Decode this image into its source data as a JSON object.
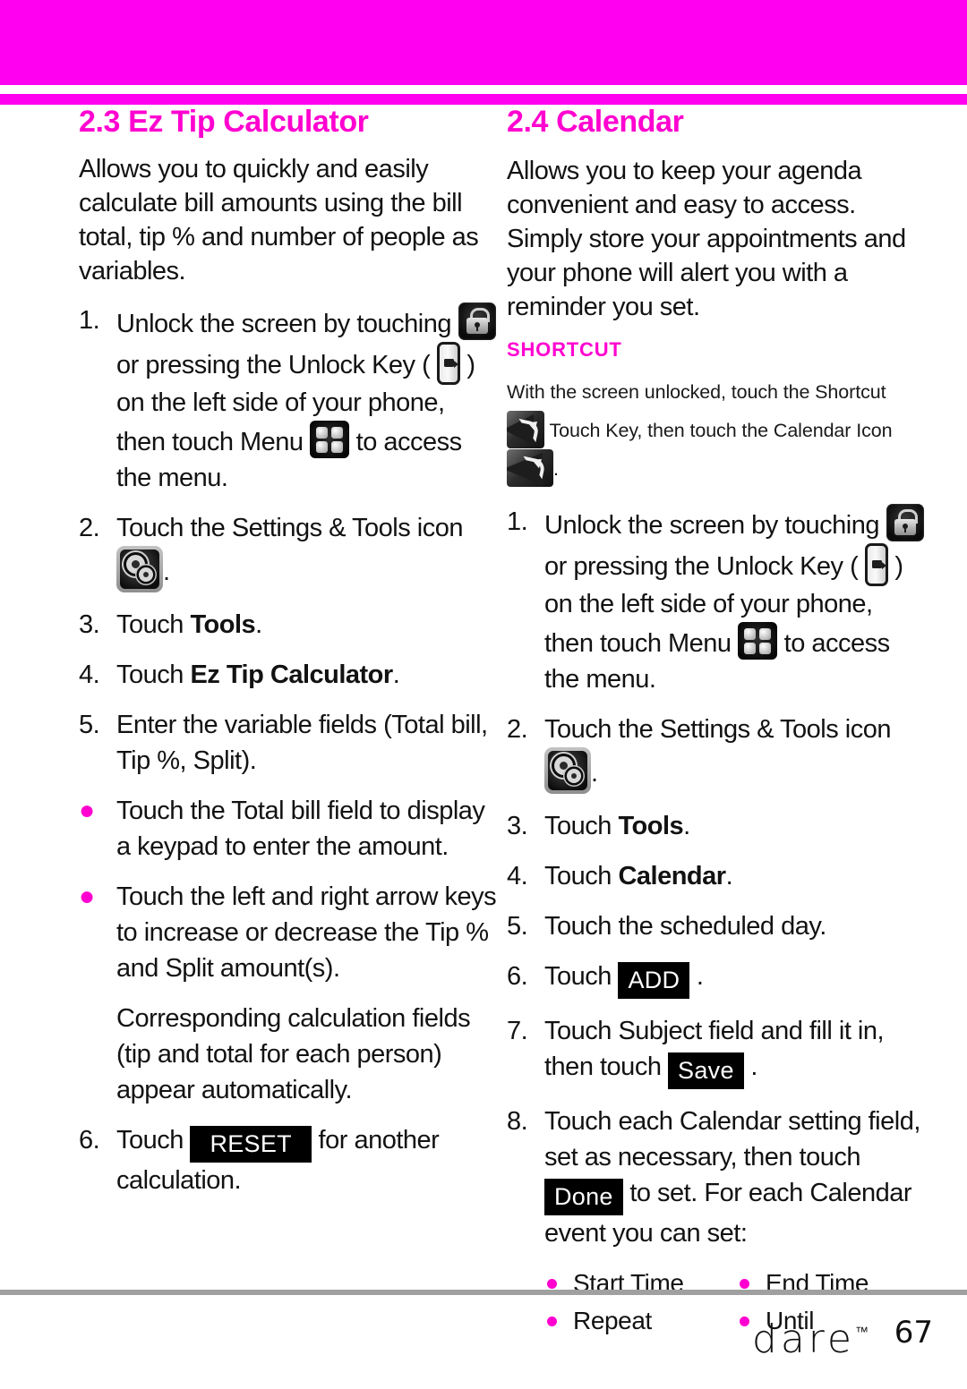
{
  "header": {
    "band_color": "#ff00f0",
    "rule_color": "#ff00f0"
  },
  "theme": {
    "accent": "#ff00d0",
    "text": "#121212",
    "keycap_bg": "#000000",
    "keycap_fg": "#ffffff",
    "footer_rule": "#a0a0a0"
  },
  "left_column": {
    "title": "2.3 Ez Tip Calculator",
    "intro": "Allows you to quickly and easily calculate bill amounts using the bill total, tip % and number of people as variables.",
    "steps": {
      "s1_num": "1.",
      "s1_a": "Unlock the screen by touching",
      "s1_b": "or pressing the Unlock Key",
      "s1_c": "(",
      "s1_d": ") on the left side of your phone, then touch Menu",
      "s1_e": "to access the menu.",
      "s2_num": "2.",
      "s2_a": "Touch the Settings & Tools icon",
      "s2_b": ".",
      "s3_num": "3.",
      "s3_a": "Touch ",
      "s3_bold": "Tools",
      "s3_b": ".",
      "s4_num": "4.",
      "s4_a": "Touch ",
      "s4_bold": "Ez Tip Calculator",
      "s4_b": ".",
      "s5_num": "5.",
      "s5_a": "Enter the variable fields (Total bill, Tip %, Split).",
      "b1_bullet": "●",
      "b1_a": "Touch the Total bill field to display a keypad to enter the amount.",
      "b2_bullet": "●",
      "b2_a": "Touch the left and right arrow keys to increase or decrease the Tip % and Split amount(s).",
      "p_note": "Corresponding calculation fields (tip and total for each person) appear automatically.",
      "s6_num": "6.",
      "s6_a": "Touch",
      "s6_key": "RESET",
      "s6_b": "for another calculation."
    }
  },
  "right_column": {
    "title": "2.4 Calendar",
    "intro": "Allows you to keep your agenda convenient and easy to access. Simply store your appointments and your phone will alert you with a reminder you set.",
    "shortcut": {
      "label": "SHORTCUT",
      "line1": "With the screen unlocked, touch the Shortcut",
      "line2": "Touch Key, then touch the Calendar Icon",
      "line3": "."
    },
    "steps": {
      "s1_num": "1.",
      "s1_a": "Unlock the screen by touching",
      "s1_b": "or pressing the Unlock Key",
      "s1_c": "(",
      "s1_d": ") on the left side of your phone, then touch Menu",
      "s1_e": "to access the menu.",
      "s2_num": "2.",
      "s2_a": "Touch the Settings & Tools icon",
      "s2_b": ".",
      "s3_num": "3.",
      "s3_a": "Touch ",
      "s3_bold": "Tools",
      "s3_b": ".",
      "s4_num": "4.",
      "s4_a": "Touch ",
      "s4_bold": "Calendar",
      "s4_b": ".",
      "s5_num": "5.",
      "s5_a": "Touch the scheduled day.",
      "s6_num": "6.",
      "s6_a": "Touch",
      "s6_key": "ADD",
      "s6_b": ".",
      "s7_num": "7.",
      "s7_a": "Touch Subject field and fill it in, then touch",
      "s7_key": "Save",
      "s7_b": ".",
      "s8_num": "8.",
      "s8_a": "Touch each Calendar setting field, set as necessary, then touch",
      "s8_key": "Done",
      "s8_b": "to set. For each Calendar event you can set:"
    },
    "event_settings": [
      "Start Time",
      "End Time",
      "Repeat",
      "Until"
    ]
  },
  "footer": {
    "brand": "dare",
    "trademark": "™",
    "page_number": "67"
  }
}
